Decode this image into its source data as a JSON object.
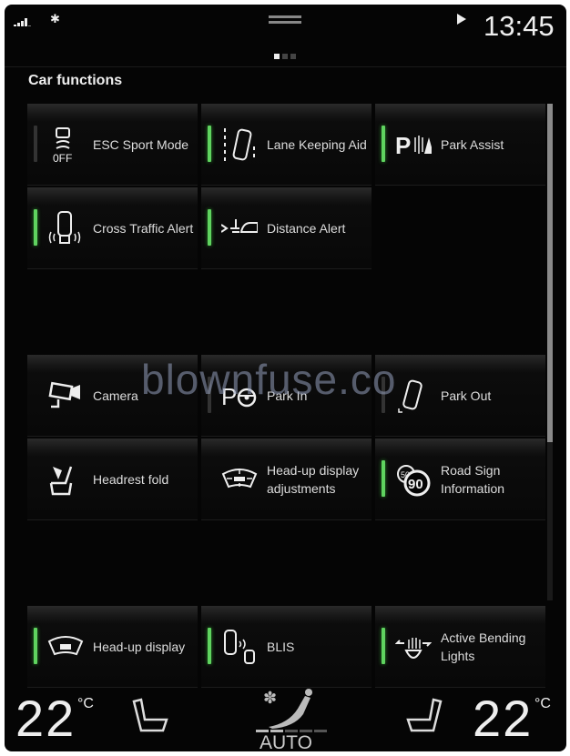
{
  "status_bar": {
    "time": "13:45",
    "signal_icon": "signal-strength-icon",
    "bluetooth_icon": "bluetooth-icon",
    "media_icon": "play-icon",
    "page_indicator": {
      "current": 1,
      "total": 3
    }
  },
  "page": {
    "title": "Car functions"
  },
  "tiles": [
    {
      "label": "ESC Sport Mode",
      "icon": "esc-off-icon",
      "indicator": "off"
    },
    {
      "label": "Lane Keeping Aid",
      "icon": "lane-keeping-icon",
      "indicator": "on"
    },
    {
      "label": "Park Assist",
      "icon": "park-assist-icon",
      "indicator": "on"
    },
    {
      "label": "Cross Traffic Alert",
      "icon": "cross-traffic-icon",
      "indicator": "on"
    },
    {
      "label": "Distance Alert",
      "icon": "distance-alert-icon",
      "indicator": "on"
    },
    {
      "label": "Camera",
      "icon": "camera-icon",
      "indicator": "none"
    },
    {
      "label": "Park In",
      "icon": "park-in-icon",
      "indicator": "off"
    },
    {
      "label": "Park Out",
      "icon": "park-out-icon",
      "indicator": "off"
    },
    {
      "label": "Headrest fold",
      "icon": "headrest-fold-icon",
      "indicator": "none"
    },
    {
      "label": "Head-up display adjustments",
      "icon": "hud-adjust-icon",
      "indicator": "none"
    },
    {
      "label": "Road Sign Information",
      "icon": "road-sign-icon",
      "indicator": "on"
    },
    {
      "label": "Head-up display",
      "icon": "hud-icon",
      "indicator": "on"
    },
    {
      "label": "BLIS",
      "icon": "blis-icon",
      "indicator": "on"
    },
    {
      "label": "Active Bending Lights",
      "icon": "bending-lights-icon",
      "indicator": "on"
    }
  ],
  "climate": {
    "left_temp": "22",
    "right_temp": "22",
    "unit": "°C",
    "mode": "AUTO",
    "fan_level": 2,
    "fan_levels": 5
  },
  "watermark": "blownfuse.co",
  "colors": {
    "active": "#5fd35f",
    "inactive": "#333333",
    "background": "#050505"
  }
}
